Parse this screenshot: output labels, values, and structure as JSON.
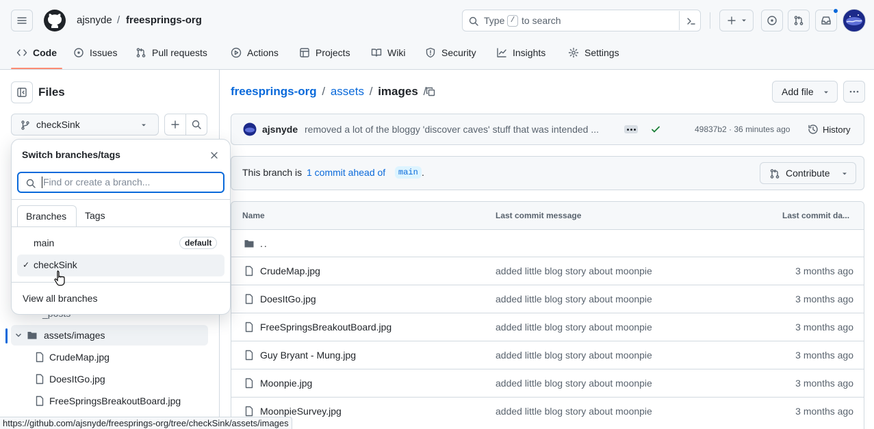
{
  "header": {
    "owner": "ajsnyde",
    "separator": "/",
    "repo": "freesprings-org",
    "search_placeholder_pre": "Type",
    "search_key": "/",
    "search_placeholder_post": "to search"
  },
  "repo_tabs": [
    {
      "label": "Code"
    },
    {
      "label": "Issues"
    },
    {
      "label": "Pull requests"
    },
    {
      "label": "Actions"
    },
    {
      "label": "Projects"
    },
    {
      "label": "Wiki"
    },
    {
      "label": "Security"
    },
    {
      "label": "Insights"
    },
    {
      "label": "Settings"
    }
  ],
  "sidebar": {
    "title": "Files",
    "branch": "checkSink",
    "tree": [
      {
        "label": "_posts"
      },
      {
        "label": "assets/images"
      },
      {
        "label": "CrudeMap.jpg"
      },
      {
        "label": "DoesItGo.jpg"
      },
      {
        "label": "FreeSpringsBreakoutBoard.jpg"
      }
    ]
  },
  "branch_popover": {
    "title": "Switch branches/tags",
    "placeholder": "Find or create a branch...",
    "tabs": [
      "Branches",
      "Tags"
    ],
    "branches": [
      {
        "name": "main",
        "badge": "default"
      },
      {
        "name": "checkSink",
        "check": "✓"
      }
    ],
    "view_all": "View all branches"
  },
  "breadcrumb": {
    "repo": "freesprings-org",
    "sep1": "/",
    "folder": "assets",
    "sep2": "/",
    "current": "images",
    "sep3": "/"
  },
  "toolbar": {
    "add_file": "Add file"
  },
  "commit": {
    "author": "ajsnyde",
    "message": "removed a lot of the bloggy 'discover caves' stuff that was intended ...",
    "sha_time": "49837b2 · 36 minutes ago",
    "history": "History"
  },
  "ahead": {
    "pre": "This branch is",
    "link": "1 commit ahead of",
    "branch": "main",
    "post": ".",
    "contribute": "Contribute"
  },
  "table": {
    "headers": [
      "Name",
      "Last commit message",
      "Last commit da..."
    ],
    "parent": "..",
    "rows": [
      {
        "name": "CrudeMap.jpg",
        "message": "added little blog story about moonpie",
        "age": "3 months ago"
      },
      {
        "name": "DoesItGo.jpg",
        "message": "added little blog story about moonpie",
        "age": "3 months ago"
      },
      {
        "name": "FreeSpringsBreakoutBoard.jpg",
        "message": "added little blog story about moonpie",
        "age": "3 months ago"
      },
      {
        "name": "Guy Bryant - Mung.jpg",
        "message": "added little blog story about moonpie",
        "age": "3 months ago"
      },
      {
        "name": "Moonpie.jpg",
        "message": "added little blog story about moonpie",
        "age": "3 months ago"
      },
      {
        "name": "MoonpieSurvey.jpg",
        "message": "added little blog story about moonpie",
        "age": "3 months ago"
      }
    ]
  },
  "status_url": "https://github.com/ajsnyde/freesprings-org/tree/checkSink/assets/images",
  "colors": {
    "accent": "#0969da",
    "success": "#1a7f37",
    "tab_underline": "#fd8c73",
    "notification": "#0969da"
  }
}
